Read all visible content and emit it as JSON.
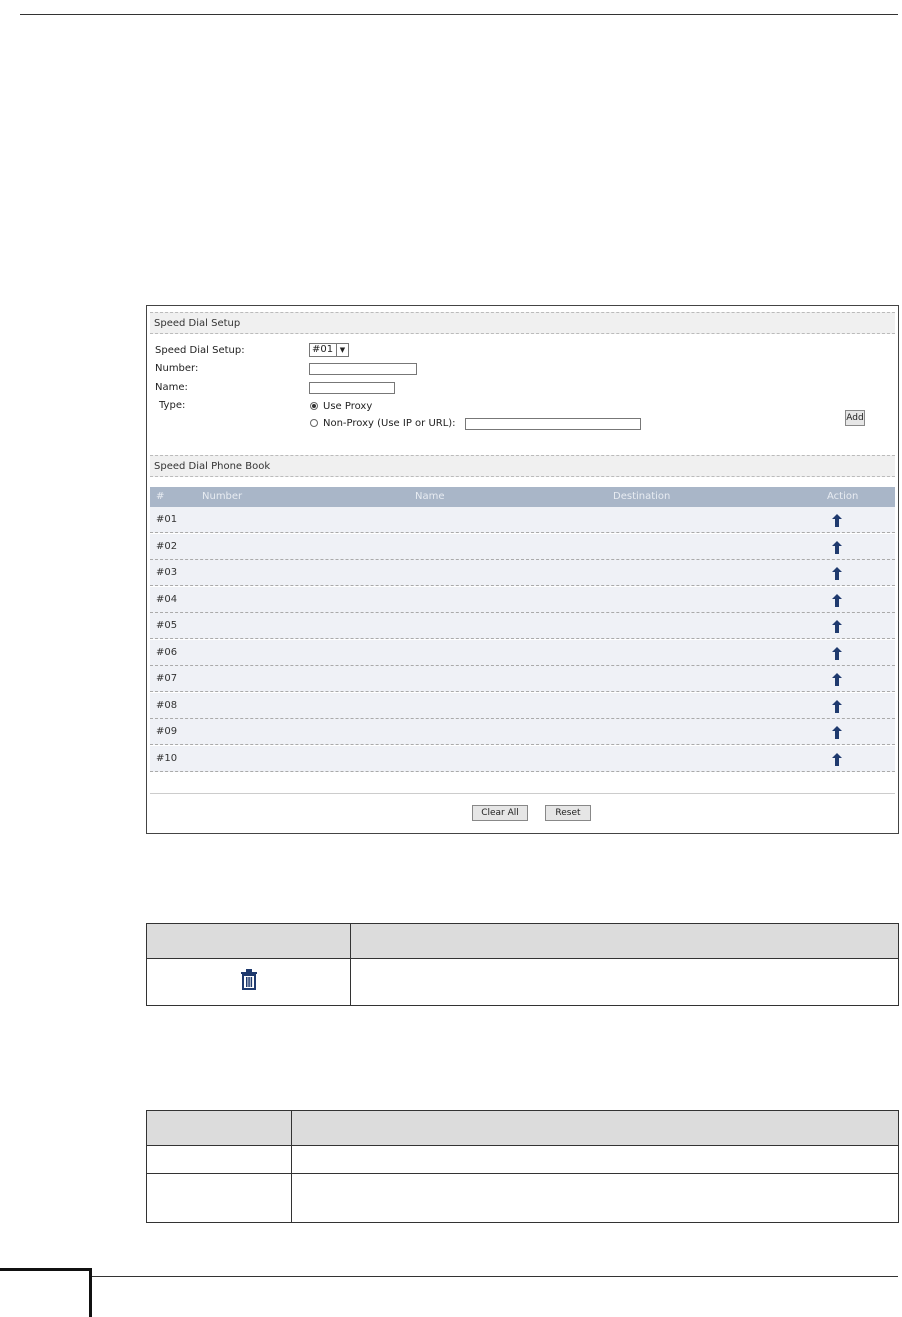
{
  "panel": {
    "setup_header": "Speed Dial Setup",
    "speed_dial_label": "Speed Dial Setup:",
    "speed_dial_value": "#01",
    "number_label": "Number:",
    "name_label": "Name:",
    "type_label": "Type:",
    "use_proxy_label": "Use Proxy",
    "non_proxy_label": "Non-Proxy (Use IP or URL):",
    "add_button": "Add",
    "phonebook_header": "Speed Dial Phone Book",
    "columns": {
      "hash": "#",
      "number": "Number",
      "name": "Name",
      "destination": "Destination",
      "action": "Action"
    },
    "rows": [
      "#01",
      "#02",
      "#03",
      "#04",
      "#05",
      "#06",
      "#07",
      "#08",
      "#09",
      "#10"
    ],
    "clear_all_button": "Clear All",
    "reset_button": "Reset"
  },
  "icons": {
    "row_action": "edit-icon",
    "table_icon": "trash-icon"
  },
  "colors": {
    "table_header": "#a9b6c8",
    "row_bg": "#eff1f6",
    "icon": "#1f3a6e"
  }
}
